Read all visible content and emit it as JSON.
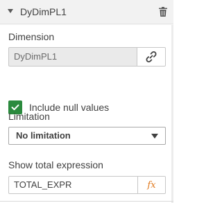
{
  "header": {
    "title": "DyDimPL1"
  },
  "dimension": {
    "label": "Dimension",
    "value": "DyDimPL1"
  },
  "include_null": {
    "label": "Include null values",
    "checked": true
  },
  "limitation": {
    "label": "Limitation",
    "selected": "No limitation"
  },
  "total_expression": {
    "label": "Show total expression",
    "value": "TOTAL_EXPR",
    "fx_label": "fx"
  },
  "icons": {
    "collapse": "caret-down-icon",
    "delete": "trash-icon",
    "link": "link-icon",
    "check": "check-icon",
    "dropdown": "dropdown-arrow-icon",
    "expression": "fx-icon"
  },
  "colors": {
    "checkbox": "#2b8a3e",
    "fx": "#e0781c"
  }
}
